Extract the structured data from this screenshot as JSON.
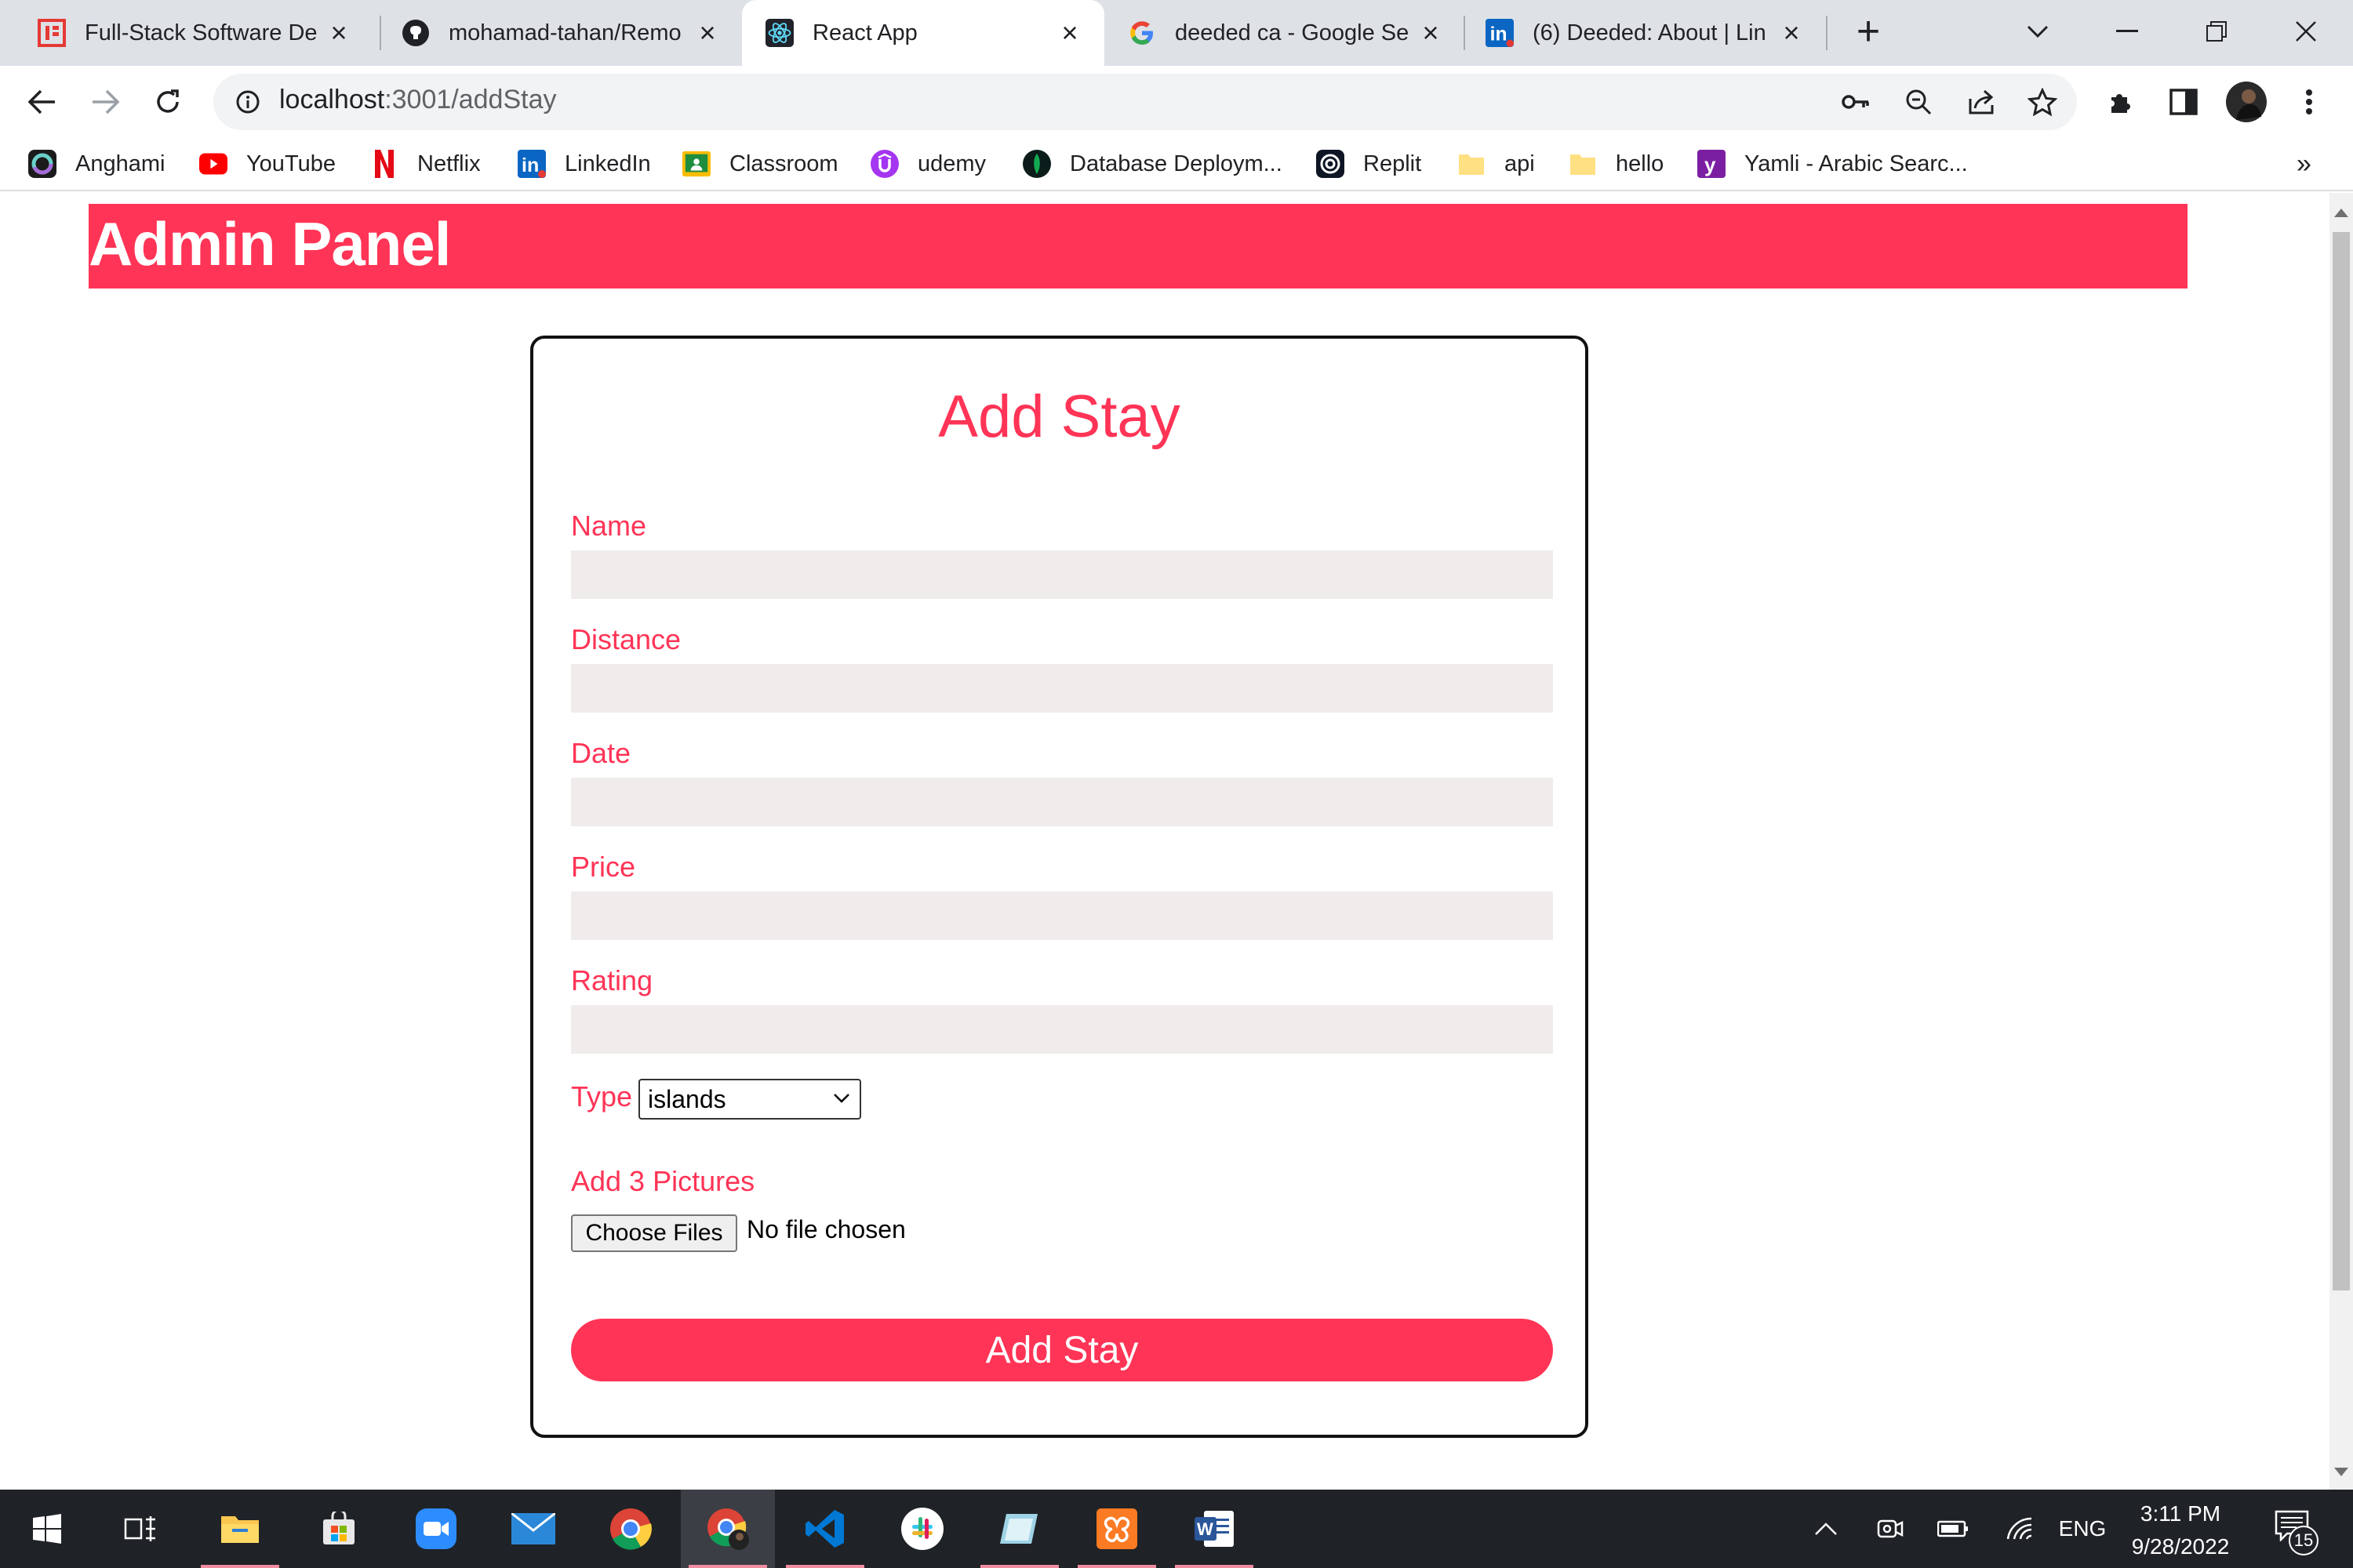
{
  "browser": {
    "tabs": [
      {
        "title": "Full-Stack Software De",
        "icon": "generic-site-icon"
      },
      {
        "title": "mohamad-tahan/Remo",
        "icon": "github-icon"
      },
      {
        "title": "React App",
        "icon": "react-icon",
        "active": true
      },
      {
        "title": "deeded ca - Google Se",
        "icon": "google-icon"
      },
      {
        "title": "(6) Deeded: About | Lin",
        "icon": "linkedin-icon"
      }
    ],
    "url_host": "localhost",
    "url_path": ":3001/addStay",
    "bookmarks": [
      {
        "label": "Anghami",
        "icon": "anghami-icon"
      },
      {
        "label": "YouTube",
        "icon": "youtube-icon"
      },
      {
        "label": "Netflix",
        "icon": "netflix-icon"
      },
      {
        "label": "LinkedIn",
        "icon": "linkedin-icon"
      },
      {
        "label": "Classroom",
        "icon": "classroom-icon"
      },
      {
        "label": "udemy",
        "icon": "udemy-icon"
      },
      {
        "label": "Database Deploym...",
        "icon": "database-icon"
      },
      {
        "label": "Replit",
        "icon": "replit-icon"
      },
      {
        "label": "api",
        "icon": "folder-icon"
      },
      {
        "label": "hello",
        "icon": "folder-icon"
      },
      {
        "label": "Yamli - Arabic Searc...",
        "icon": "yamli-icon"
      }
    ],
    "more_bookmarks": "»"
  },
  "page": {
    "header_title": "Admin Panel",
    "form": {
      "title": "Add Stay",
      "fields": [
        {
          "label": "Name",
          "value": ""
        },
        {
          "label": "Distance",
          "value": ""
        },
        {
          "label": "Date",
          "value": ""
        },
        {
          "label": "Price",
          "value": ""
        },
        {
          "label": "Rating",
          "value": ""
        }
      ],
      "type_label": "Type",
      "type_value": "islands",
      "pictures_label": "Add 3 Pictures",
      "choose_files": "Choose Files",
      "no_file": "No file chosen",
      "submit": "Add Stay"
    }
  },
  "taskbar": {
    "apps": [
      "start-icon",
      "task-view-icon",
      "file-explorer-icon",
      "store-icon",
      "zoom-icon",
      "mail-icon",
      "chrome-icon",
      "chrome-profile-icon",
      "vscode-icon",
      "slack-icon",
      "notes-icon",
      "xampp-icon",
      "word-icon"
    ],
    "language": "ENG",
    "time": "3:11 PM",
    "date": "9/28/2022",
    "notifications": "15"
  },
  "colors": {
    "accent": "#ff3456",
    "input_bg": "#f0ecec",
    "tabstrip_bg": "#dee1e6",
    "taskbar_bg": "#1f2226"
  }
}
